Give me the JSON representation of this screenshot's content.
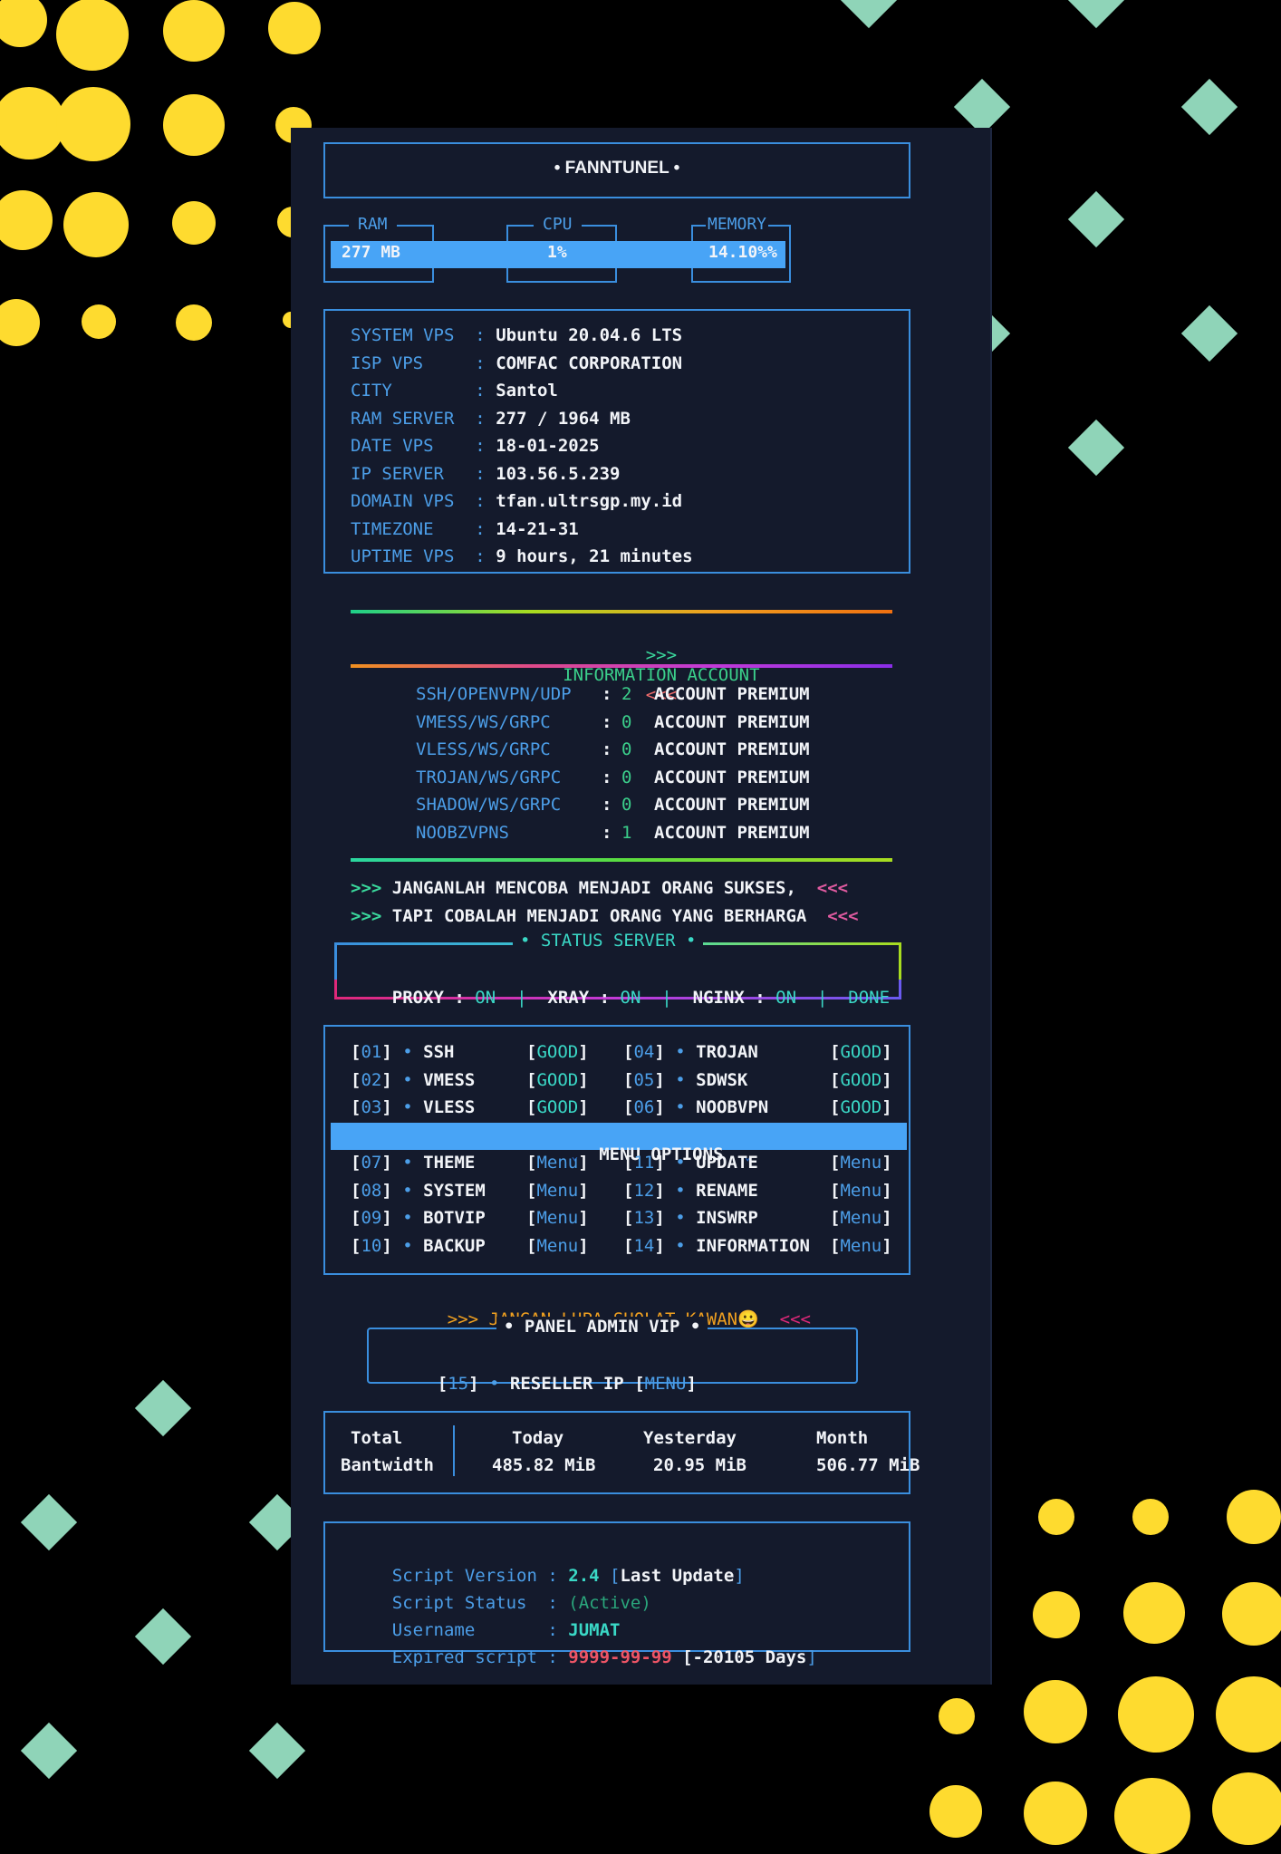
{
  "header": {
    "title": "• FANNTUNEL •"
  },
  "stats": {
    "ram_label": "RAM",
    "cpu_label": "CPU",
    "memory_label": "MEMORY",
    "ram_value": "277 MB",
    "cpu_value": "1%",
    "memory_value": "14.10%%"
  },
  "system_info": [
    {
      "label": "SYSTEM VPS ",
      "sep": ":",
      "value": "Ubuntu 20.04.6 LTS"
    },
    {
      "label": "ISP VPS    ",
      "sep": ":",
      "value": "COMFAC CORPORATION"
    },
    {
      "label": "CITY       ",
      "sep": ":",
      "value": "Santol"
    },
    {
      "label": "RAM SERVER ",
      "sep": ":",
      "value": "277 / 1964 MB"
    },
    {
      "label": "DATE VPS   ",
      "sep": ":",
      "value": "18-01-2025"
    },
    {
      "label": "IP SERVER  ",
      "sep": ":",
      "value": "103.56.5.239"
    },
    {
      "label": "DOMAIN VPS ",
      "sep": ":",
      "value": "tfan.ultrsgp.my.id"
    },
    {
      "label": "TIMEZONE   ",
      "sep": ":",
      "value": "14-21-31"
    },
    {
      "label": "UPTIME VPS ",
      "sep": ":",
      "value": "9 hours, 21 minutes"
    }
  ],
  "info_account": {
    "arrow_left": ">>>",
    "title": "INFORMATION ACCOUNT",
    "arrow_right": "<<<"
  },
  "accounts": [
    {
      "name": "SSH/OPENVPN/UDP",
      "sep": ":",
      "count": "2",
      "text": "ACCOUNT PREMIUM"
    },
    {
      "name": "VMESS/WS/GRPC",
      "sep": ":",
      "count": "0",
      "text": "ACCOUNT PREMIUM"
    },
    {
      "name": "VLESS/WS/GRPC",
      "sep": ":",
      "count": "0",
      "text": "ACCOUNT PREMIUM"
    },
    {
      "name": "TROJAN/WS/GRPC",
      "sep": ":",
      "count": "0",
      "text": "ACCOUNT PREMIUM"
    },
    {
      "name": "SHADOW/WS/GRPC",
      "sep": ":",
      "count": "0",
      "text": "ACCOUNT PREMIUM"
    },
    {
      "name": "NOOBZVPNS",
      "sep": ":",
      "count": "1",
      "text": "ACCOUNT PREMIUM"
    }
  ],
  "quotes": [
    {
      "left": ">>>",
      "text": "JANGANLAH MENCOBA MENJADI ORANG SUKSES,",
      "right": "<<<"
    },
    {
      "left": ">>>",
      "text": "TAPI COBALAH MENJADI ORANG YANG BERHARGA",
      "right": "<<<"
    }
  ],
  "status_server": {
    "title": "• STATUS SERVER •",
    "proxy_label": "PROXY :",
    "proxy_value": "ON",
    "xray_label": "XRAY :",
    "xray_value": "ON",
    "nginx_label": "NGINX :",
    "nginx_value": "ON",
    "pipe": "|",
    "done": "DONE"
  },
  "menu": {
    "services": [
      {
        "num": "01",
        "name": "SSH",
        "status": "GOOD"
      },
      {
        "num": "02",
        "name": "VMESS",
        "status": "GOOD"
      },
      {
        "num": "03",
        "name": "VLESS",
        "status": "GOOD"
      },
      {
        "num": "04",
        "name": "TROJAN",
        "status": "GOOD"
      },
      {
        "num": "05",
        "name": "SDWSK",
        "status": "GOOD"
      },
      {
        "num": "06",
        "name": "NOOBVPN",
        "status": "GOOD"
      }
    ],
    "options_title": "MENU OPTIONS",
    "options": [
      {
        "num": "07",
        "name": "THEME",
        "status": "Menu"
      },
      {
        "num": "08",
        "name": "SYSTEM",
        "status": "Menu"
      },
      {
        "num": "09",
        "name": "BOTVIP",
        "status": "Menu"
      },
      {
        "num": "10",
        "name": "BACKUP",
        "status": "Menu"
      },
      {
        "num": "11",
        "name": "UPDATE",
        "status": "Menu"
      },
      {
        "num": "12",
        "name": "RENAME",
        "status": "Menu"
      },
      {
        "num": "13",
        "name": "INSWRP",
        "status": "Menu"
      },
      {
        "num": "14",
        "name": "INFORMATION",
        "status": "Menu"
      }
    ]
  },
  "sholat": {
    "left": ">>>",
    "text": "JANGAN LUPA SHOLAT KAWAN😀",
    "right": "<<<"
  },
  "panel_admin": {
    "title": "• PANEL ADMIN VIP •",
    "num": "15",
    "name": "RESELLER IP",
    "status": "MENU"
  },
  "bandwidth": {
    "label_1": "Total",
    "label_2": "Bantwidth",
    "today_label": "Today",
    "today_value": "485.82 MiB",
    "yesterday_label": "Yesterday",
    "yesterday_value": "20.95 MiB",
    "month_label": "Month",
    "month_value": "506.77 MiB"
  },
  "script_info": {
    "version_label": "Script Version :",
    "version_value": "2.4",
    "version_note": "Last Update",
    "status_label": "Script Status  :",
    "status_value": "(Active)",
    "username_label": "Username       :",
    "username_value": "JUMAT",
    "expired_label": "Expired script :",
    "expired_value": "9999-99-99",
    "expired_days": "-20105 Days"
  },
  "colors": {
    "terminal_bg": "#141a2c",
    "accent_blue": "#48a4f6",
    "dot_yellow": "#fedb2f",
    "diamond_green": "#8fd4b8"
  }
}
